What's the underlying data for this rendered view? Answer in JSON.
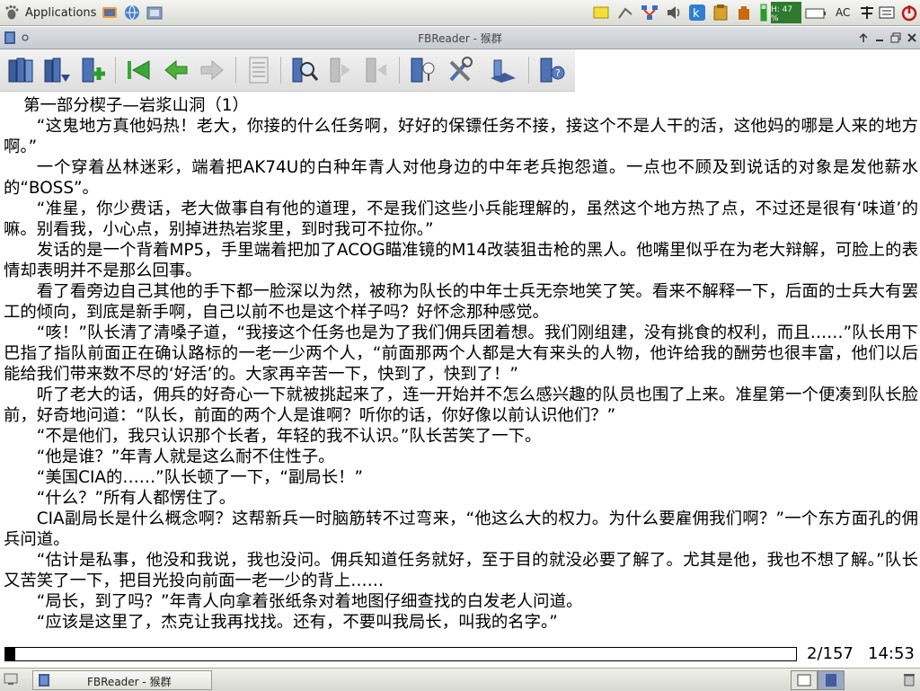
{
  "top_panel": {
    "applications_label": "Applications",
    "cpu_label": "H: 47 %",
    "ac_label": "AC"
  },
  "window": {
    "title": "FBReader - 猴群"
  },
  "toolbar": {
    "buttons": [
      "library-icon",
      "recent-books-icon",
      "add-book-icon",
      "go-start-icon",
      "back-icon",
      "forward-icon",
      "toc-icon",
      "search-icon",
      "find-next-icon",
      "find-previous-icon",
      "book-info-icon",
      "preferences-icon",
      "rotate-screen-icon",
      "help-icon"
    ]
  },
  "book": {
    "chapter_title": "第一部分楔子—岩浆山洞（1）",
    "paragraphs": [
      "“这鬼地方真他妈热！老大，你接的什么任务啊，好好的保镖任务不接，接这个不是人干的活，这他妈的哪是人来的地方啊。”",
      "一个穿着丛林迷彩，端着把AK74U的白种年青人对他身边的中年老兵抱怨道。一点也不顾及到说话的对象是发他薪水的“BOSS”。",
      "“准星，你少费话，老大做事自有他的道理，不是我们这些小兵能理解的，虽然这个地方热了点，不过还是很有‘味道’的嘛。别看我，小心点，别掉进热岩浆里，到时我可不拉你。”",
      "发话的是一个背着MP5，手里端着把加了ACOG瞄准镜的M14改装狙击枪的黑人。他嘴里似乎在为老大辩解，可脸上的表情却表明并不是那么回事。",
      "看了看旁边自己其他的手下都一脸深以为然，被称为队长的中年士兵无奈地笑了笑。看来不解释一下，后面的士兵大有罢工的倾向，到底是新手啊，自己以前不也是这个样子吗？好怀念那种感觉。",
      "“咳！”队长清了清嗓子道，“我接这个任务也是为了我们佣兵团着想。我们刚组建，没有挑食的权利，而且……”队长用下巴指了指队前面正在确认路标的一老一少两个人，“前面那两个人都是大有来头的人物，他许给我的酬劳也很丰富，他们以后能给我们带来数不尽的‘好活’的。大家再辛苦一下，快到了，快到了！”",
      "听了老大的话，佣兵的好奇心一下就被挑起来了，连一开始并不怎么感兴趣的队员也围了上来。准星第一个便凑到队长脸前，好奇地问道：“队长，前面的两个人是谁啊？听你的话，你好像以前认识他们？”",
      "“不是他们，我只认识那个长者，年轻的我不认识。”队长苦笑了一下。",
      "“他是谁？”年青人就是这么耐不住性子。",
      "“美国CIA的……”队长顿了一下，“副局长！”",
      "“什么？”所有人都愣住了。",
      "CIA副局长是什么概念啊？这帮新兵一时脑筋转不过弯来，“他这么大的权力。为什么要雇佣我们啊？”一个东方面孔的佣兵问道。",
      "“估计是私事，他没和我说，我也没问。佣兵知道任务就好，至于目的就没必要了解了。尤其是他，我也不想了解。”队长又苦笑了一下，把目光投向前面一老一少的背上……",
      "“局长，到了吗？”年青人向拿着张纸条对着地图仔细查找的白发老人问道。",
      "“应该是这里了，杰克让我再找找。还有，不要叫我局长，叫我的名字。”"
    ]
  },
  "status": {
    "page": "2/157",
    "time": "14:53",
    "progress_fraction": 0.0127
  },
  "taskbar": {
    "task_label": "FBReader - 猴群"
  }
}
